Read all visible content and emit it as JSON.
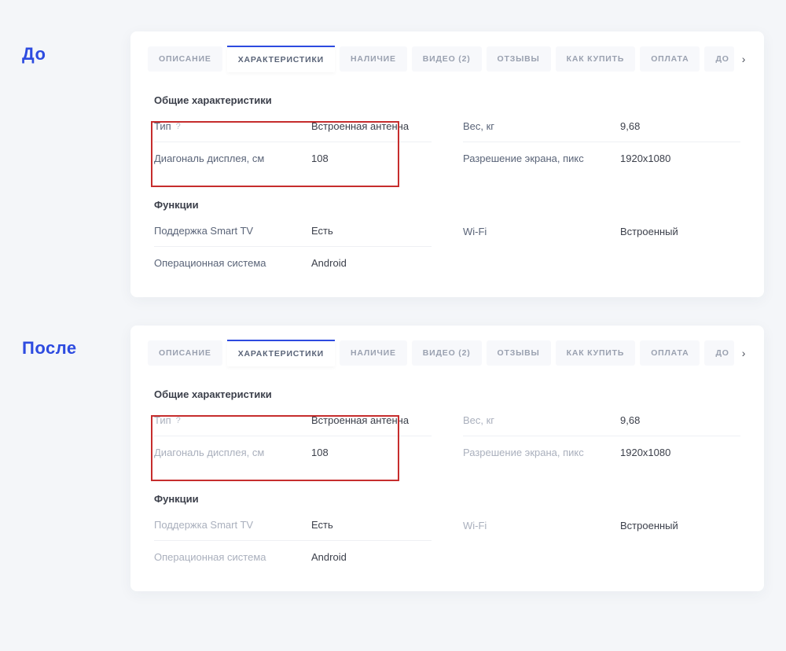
{
  "labels": {
    "before": "До",
    "after": "После"
  },
  "tabs": [
    {
      "label": "ОПИСАНИЕ",
      "active": false
    },
    {
      "label": "ХАРАКТЕРИСТИКИ",
      "active": true
    },
    {
      "label": "НАЛИЧИЕ",
      "active": false
    },
    {
      "label": "ВИДЕО  (2)",
      "active": false
    },
    {
      "label": "ОТЗЫВЫ",
      "active": false
    },
    {
      "label": "КАК КУПИТЬ",
      "active": false
    },
    {
      "label": "ОПЛАТА",
      "active": false
    },
    {
      "label": "ДО",
      "active": false,
      "partial": true
    }
  ],
  "sections": {
    "general": {
      "title": "Общие характеристики",
      "left": [
        {
          "key": "Тип",
          "help": "?",
          "val": "Встроенная антенна"
        },
        {
          "key": "Диагональ дисплея, см",
          "val": "108"
        }
      ],
      "right": [
        {
          "key": "Вес, кг",
          "val": "9,68"
        },
        {
          "key": "Разрешение экрана, пикс",
          "val": "1920x1080"
        }
      ]
    },
    "functions": {
      "title": "Функции",
      "left": [
        {
          "key": "Поддержка Smart TV",
          "val": "Есть"
        },
        {
          "key": "Операционная система",
          "val": "Android"
        }
      ],
      "right": [
        {
          "key": "Wi-Fi",
          "val": "Встроенный"
        }
      ]
    }
  }
}
